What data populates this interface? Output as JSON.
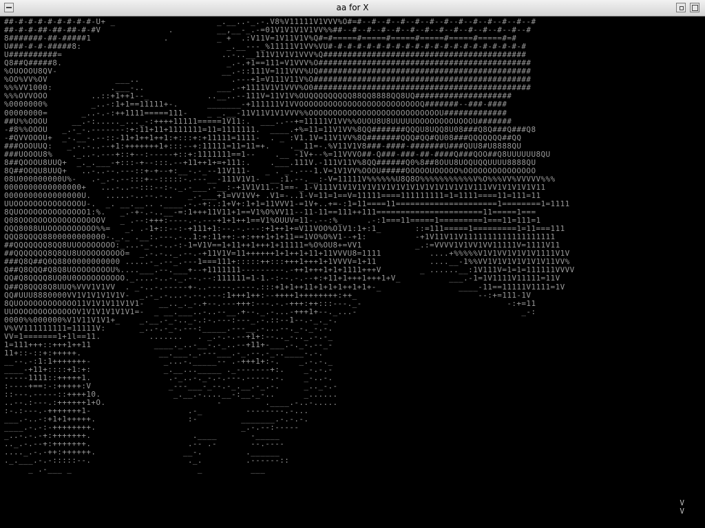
{
  "window": {
    "title": "aa for X",
    "colors": {
      "titlebar_top": "#f2f2f2",
      "titlebar_bottom": "#d4d4d4",
      "content_bg": "#000000",
      "glyph": "#9a9a9a"
    },
    "icons": [
      "window-menu-icon",
      "minimize-icon",
      "maximize-icon"
    ]
  },
  "ascii_art": {
    "lines": [
      "##-#-#-#-#-#-#-#-#-U+ _                     _.__..-_.-.V8%V11111V1VVV%O#=#--#--#--#--#--#--#--#--#--#--#--#--#",
      "##-#-#-##-##-##-#-#V              .         __,__-_.-=01V1V1V1V1VV%%##--#--#--#--#--#--#--#--#--#--#--#--#--#",
      "8#######-##-#####1               .          _ +  .:V11V=1V11V1V%Q#=#=====#=====#=====#=====#=====#=====#=#",
      "U###-#-#-#####8:                              _.__---_%11111V1VV%VU#-#-#-#-#-#-#-#-#-#-#-#-#-#-#-#-#-#-#-#-#",
      "U##########=                                 ..-..__111V1V1V1VVV%Q##########################################",
      "Q8##Q#####8.                                  _.-.+1==111=V1VVV%O############################################",
      "%OUOOOU8QV-                                  __.-::111V=111VVV%UQ############################################",
      "%OO%VV%OV              ___..                   .---+1=V111V11V%O#############################################",
      "%%%VV1000:            .___-..               ___.-+1111V1V1VVV%O0#############################################",
      "%%%OVVOOO         ..::+1++1--_            ..__..--111V=11V1V%OUQQQQQQQQQ88QQ8888QQ8UQ####################",
      "%0000000%         _..-:1+1==11111+-.      _______-+111111V1VVOOOOOOOOOOOOOOOOOOOOOOOOOQ#######--###-####",
      "00000000=       _..-.-:++1111=====111-    _ _.__-11V11V1V1VVV%%OOOOOOOOOOOOOOOOOOOOOOOOOOOU#############",
      "##U%%OOOU     __.-:....._..._-:++++11111=====1V11:.  ___..--+=11111V1VV%%OUOU8U8UUUUUOOOOOOOOUOOOU#######",
      "-#8%%OOOU   _.-_-.-------:+:11+11+1111111=11=1111111.  ____.+%=11=11V1VV%8QQ#######QQQU8UQQ8U08###Q8Q###Q###Q8",
      "-#QVVOOOU+  _-.__-.--::-11+1++1++1:+:::+:+11111=1111-  . _ :V1.1V=11V1VV%8Q#######QQQ#QQ#QU08###QQQQQQQ##QQ",
      "###OOOUUQ:   _.-.-..--+1:+++++++1+:::--+:11111=11=11=+.    .__11=-.%V11V1V8###-####-#######U###QUU8#U8888QU",
      "###UOOOU8%    ._..-.---+::+--:-----+::+:1111111==1--    .__ -1V+--%=11VVVO##-Q###-###-##-####Q###QOO##Q8UUUUUU8QU",
      "8##QOOOU8UUQ+  _._.___-+:::-+--:::.--+11++1+=+111:.    .___.111V.-111V11V%8QQ######Q0%8##8OUU8UOQUQQUUUU8888QU",
      "8Q##OOQU8UUQ+   ..-..--.---::+-+--+:__-.-_--11V111-   _ . _-.---1.V=1V1VV%OOOU#####OOOOOUOOOOO%OOOOOOOOOOOOOOO",
      "08U000000000U%-   .-_.-.--:::+--:::::-.---__-111V1V1-  __:1.--.__:-V=11111V%%%%%%U8Q8O%%%%%%%%%%%V%O%%%VV%VVVVV%%%",
      "0000000000000000+   ...-..--:::--:-._.-___.-__:-+1V1V11.-1==-_1-V111V1V1V1V1V1V1V1V1V1V1V1V1V1V1V111VV1V1V1V1V11",
      "0000000000000000U.   .....-..--.-..   _.-___+1=VV1VV+ .V1=-..1-V=11=1==V=11111====111111111=1=1111====11=111=11",
      "UUOOOOOOOOOOOOOOU-.  _. __.__.. .____.-.-+:.:1+V+:1+1=11VVV1-=1V+..+=-:1=11====11=====================1========1=1111",
      "8QUOOOOOOOOOOOOOO1:%.   _.-+-.-..__-=:1+++11V11+1==V1%O%VV11--11-11==111++111======================11=====1===",
      "Q08OOOOOOOOOOOOOOOOOV   _ .--:+++:----.-.---+1+1++1==V1%OUUV=11-.--:%_     .-:1===11=====1=========1===11=111=1",
      "QQQ8088UUOOOOOOOOOO%%=   _. .-1+::--:-+111+1:--.-.---:+1++1+=V11VOO%O1V1:1+:1_       ::=111=====1=========1=11===111",
      "QQQ8QQQQ8800000000000-._._ .__:.---.-..1:+:11++:-+:+++1+1+11==1VO%O%V1--+1:          -+1V11V11V1111111111111111111",
      "##QQQQQQQ8QQ8UUOOOOOOOO:_...-_-.-..-:-1=V1V==1+11++1+++1+11111=%O%OU8+=VV1           _.:=VVVV1V1VV1VV11111V=1111V11",
      "##QQQQQQQ8Q8QU8UOOOOOOOOO=  _.-.-.._.--.-+11V1V=11++++++1+1++1+11+11VVVU8=1111          ....+%%%%%V1V1VV1V1V1V1111V1V",
      "###Q8Q##Q0Q8800000000000 .....-_.--_.---1===111+:::::++:::+++1+++1+1VVVV=1+11           ....__-1%%VV1V1V1V1V1V1V11VV%",
      "Q##Q8QQQ#Q8Q8UOOOOOOOOU%....___.--.___+--+1111111---------.-++1+++1+1+1111+++V        _ ......__:1V111V=1=1=111111VVVV",
      "QQ#Q8QQQQ8UQ0U0OOOOOOOOOO._....-..-._.--.--:111111=1-1.-:--.-.--+:+11+1+++1+++1+V_          ___.-1=1V1111V11111=11V",
      "Q##Q8QQQ8Q8UUQ%VVV1V1VV  . _-..-.-----+-..-----.----.:::+1+1++11+1+1+1++1+1+-_                ____-11==11111V1111=1V",
      "QQ#UUU8880000VV1V1V1V1V1V-  _.-_.-...-.--.---:1+++1++:--++++1++++++++:++_                         --:+=111-1V",
      "8QUOOOOOOOOOOOO11V1V1V11V1V1-   __.._._-.+--.---+++:---.-.-+++:++:::---._-                              -:+=11",
      "UUOOOOOOOOOOOOOV1V1V1V1V1V1=-  _ __.___..-..--__.+--._.-...-+++1+--._...-                                  _-:",
      "0000%%000000%V1V11V1V1+_    _.__.-_-.._-.:-.---:---_.-.::--1--.-_._-.",
      "V%VV111111111=11111V:       _..-.-_-.---:_____.---__.-...--._-._-.-.",
      "VV=1=======1+1l==11.          .......   . _.-.-.--+1+:--.._-.._.-.-_",
      "1=111+++::+++1++11             ____._..-__-.-_..--+11+-___.-._-.--_-",
      "11+::-::+:+++++.                __.___._.---___.-_.--.-_..____-.-.",
      "__--.-:1:1+++++++-               _...-._____-- .-+++1+:-.    _.-.-._",
      "____-+11+::::+1:+:               _.__..._____ ._-------+:.    _-.-.-",
      "-----1111::+++++1.                .-_..-._-.-.---.-----.-.    _-..-.",
      ":----+==:-:+++++:V                _---___-_--.-_.__.-_.-.     _.._-.-",
      "::---.-----::++++10.               _.__.-....__-:__._-..      _......",
      "..--.:---.:++++++1+O.                       -         .____.-..-.....",
      ":-.:---.-+++++++1-                    .-_         --------.-...",
      "___.-..-:+1+1+++++.                   :-         _______.-.-.-.",
      "____.-.-:-++++++++.                              _.-.--:-----",
      "_..-.-.-+:+++++++.                     .____       -_____",
      ".._.-.--+:+++++++.                    .-- .-       --.----",
      "...._.-.-++:++++++.                  __-.         .______",
      "._.___.-.-:::::--.                    ._.         .------::",
      "     _ .-___ _                          _          ___"
    ],
    "corner_glyphs": "V\nV"
  }
}
